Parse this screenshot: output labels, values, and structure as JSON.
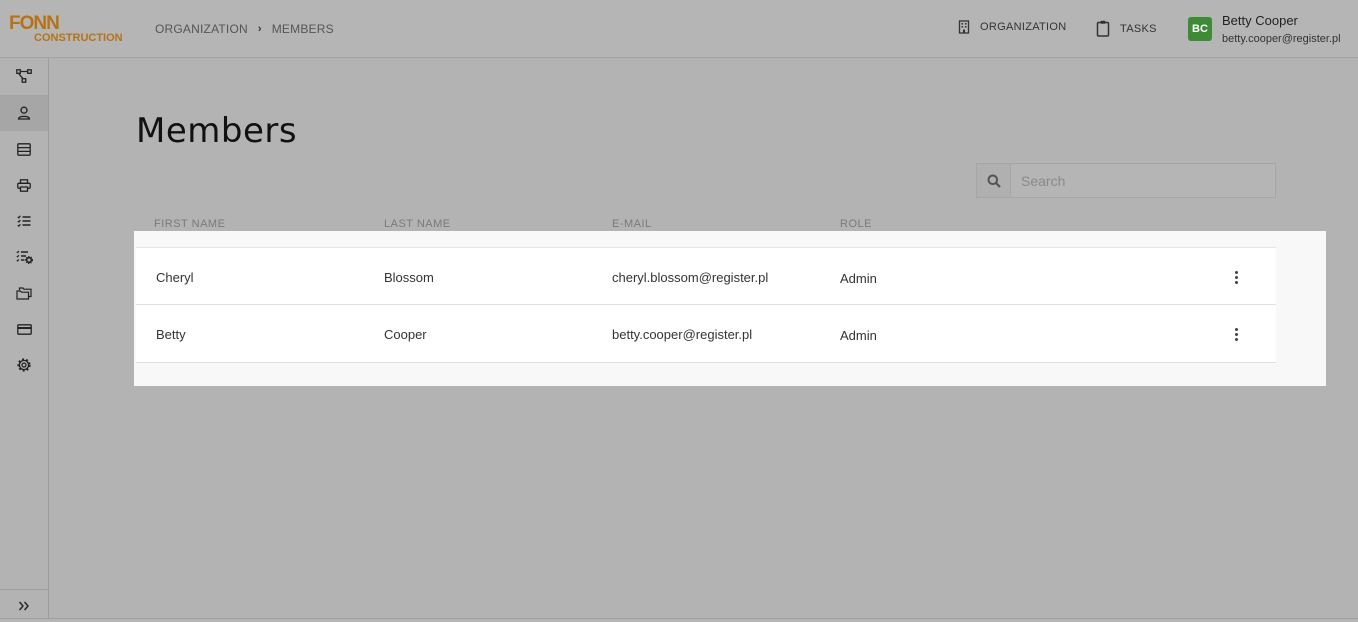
{
  "logo": {
    "line1": "FONN",
    "line2": "CONSTRUCTION"
  },
  "breadcrumb": {
    "items": [
      "ORGANIZATION",
      "MEMBERS"
    ],
    "separator": "›"
  },
  "header": {
    "organization_label": "ORGANIZATION",
    "tasks_label": "TASKS",
    "user": {
      "initials": "BC",
      "name": "Betty Cooper",
      "email": "betty.cooper@register.pl"
    }
  },
  "sidebar": {
    "items": [
      {
        "icon": "workflow-icon"
      },
      {
        "icon": "user-icon",
        "active": true
      },
      {
        "icon": "database-icon"
      },
      {
        "icon": "printer-icon"
      },
      {
        "icon": "checklist-icon"
      },
      {
        "icon": "task-settings-icon"
      },
      {
        "icon": "folders-icon"
      },
      {
        "icon": "credit-card-icon"
      },
      {
        "icon": "gear-icon"
      }
    ],
    "expand_icon": "double-chevron-right-icon"
  },
  "main": {
    "title": "Members",
    "search": {
      "placeholder": "Search"
    },
    "columns": [
      "FIRST NAME",
      "LAST NAME",
      "E-MAIL",
      "ROLE"
    ],
    "rows": [
      {
        "first_name": "Cheryl",
        "last_name": "Blossom",
        "email": "cheryl.blossom@register.pl",
        "role": "Admin"
      },
      {
        "first_name": "Betty",
        "last_name": "Cooper",
        "email": "betty.cooper@register.pl",
        "role": "Admin"
      }
    ]
  },
  "colors": {
    "brand": "#b67316",
    "avatar": "#3d8b37",
    "overlay": "#b3b3b3"
  }
}
